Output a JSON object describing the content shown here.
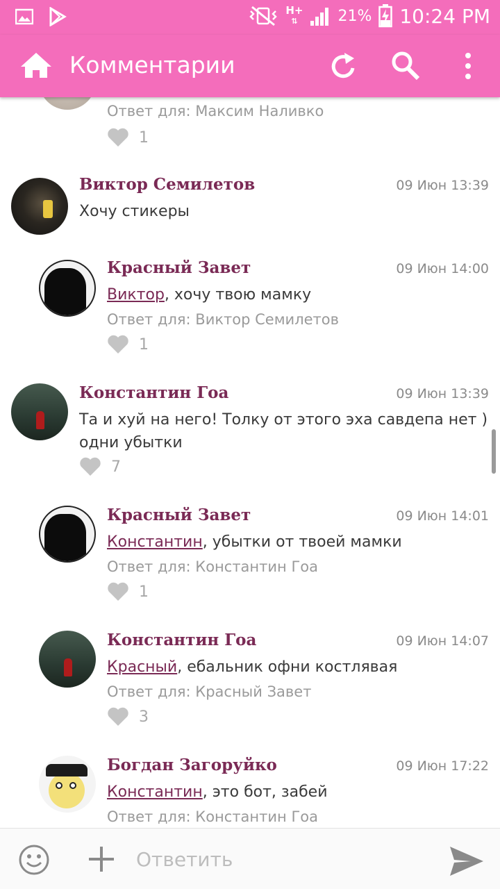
{
  "status_bar": {
    "network": "H+",
    "battery": "21%",
    "time": "10:24 PM"
  },
  "toolbar": {
    "title": "Комментарии"
  },
  "comments": [
    {
      "author": "",
      "date": "",
      "mention": "",
      "text": "",
      "reply_to": "Ответ для: Максим Наливко",
      "likes": "1"
    },
    {
      "author": "Виктор Семилетов",
      "date": "09 Июн 13:39",
      "mention": "",
      "text": "Хочу стикеры",
      "reply_to": "",
      "likes": ""
    },
    {
      "author": "Красный Завет",
      "date": "09 Июн 14:00",
      "mention": "Виктор",
      "text": ", хочу твою мамку",
      "reply_to": "Ответ для: Виктор Семилетов",
      "likes": "1"
    },
    {
      "author": "Константин Гоа",
      "date": "09 Июн 13:39",
      "mention": "",
      "text": "Та и хуй на него! Толку от этого эха савдепа нет ) одни убытки",
      "reply_to": "",
      "likes": "7"
    },
    {
      "author": "Красный Завет",
      "date": "09 Июн 14:01",
      "mention": "Константин",
      "text": ", убытки от твоей мамки",
      "reply_to": "Ответ для: Константин Гоа",
      "likes": "1"
    },
    {
      "author": "Константин Гоа",
      "date": "09 Июн 14:07",
      "mention": "Красный",
      "text": ", ебальник офни костлявая",
      "reply_to": "Ответ для: Красный Завет",
      "likes": "3"
    },
    {
      "author": "Богдан Загоруйко",
      "date": "09 Июн 17:22",
      "mention": "Константин",
      "text": ", это бот, забей",
      "reply_to": "Ответ для: Константин Гоа",
      "likes": ""
    }
  ],
  "input": {
    "placeholder": "Ответить"
  },
  "colors": {
    "accent": "#f46dbb",
    "author": "#7a2a55"
  }
}
